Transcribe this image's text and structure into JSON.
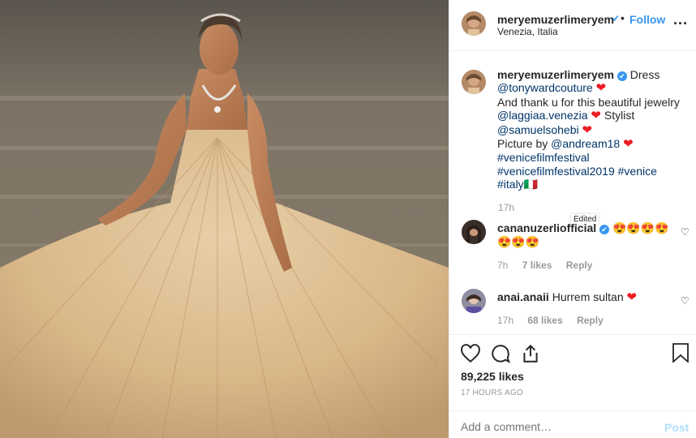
{
  "header": {
    "username": "meryemuzerlimeryem",
    "verified_mark": "✔",
    "separator": "•",
    "follow_label": "Follow",
    "location": "Venezia, Italia",
    "more_label": "..."
  },
  "caption": {
    "username": "meryemuzerlimeryem",
    "lines": [
      "Dress",
      "@tonywardcouture",
      "And thank u for this beautiful jewelry",
      "@laggiaa.venezia",
      "Stylist",
      "@samuelsohebi",
      "Picture by",
      "@andream18",
      "#venicefilmfestival",
      "#venicefilmfestival2019",
      "#venice",
      "#italy"
    ],
    "heart": "❤",
    "flag": "🇮🇹",
    "time": "17h",
    "edited_tooltip": "Edited"
  },
  "comments": [
    {
      "username": "cananuzerliofficial",
      "text": "😍😍😍😍😍😍😍",
      "time": "7h",
      "likes": "7 likes",
      "reply": "Reply"
    },
    {
      "username": "anai.anaii",
      "text": "Hurrem sultan",
      "heart": "❤",
      "time": "17h",
      "likes": "68 likes",
      "reply": "Reply"
    }
  ],
  "actions": {
    "likes_count": "89,225 likes",
    "posted_ago": "17 HOURS AGO"
  },
  "add_comment": {
    "placeholder": "Add a comment…",
    "post_label": "Post"
  },
  "colors": {
    "link": "#003569",
    "accent": "#3897f0",
    "heart": "#ed1c24",
    "muted": "#999999"
  }
}
